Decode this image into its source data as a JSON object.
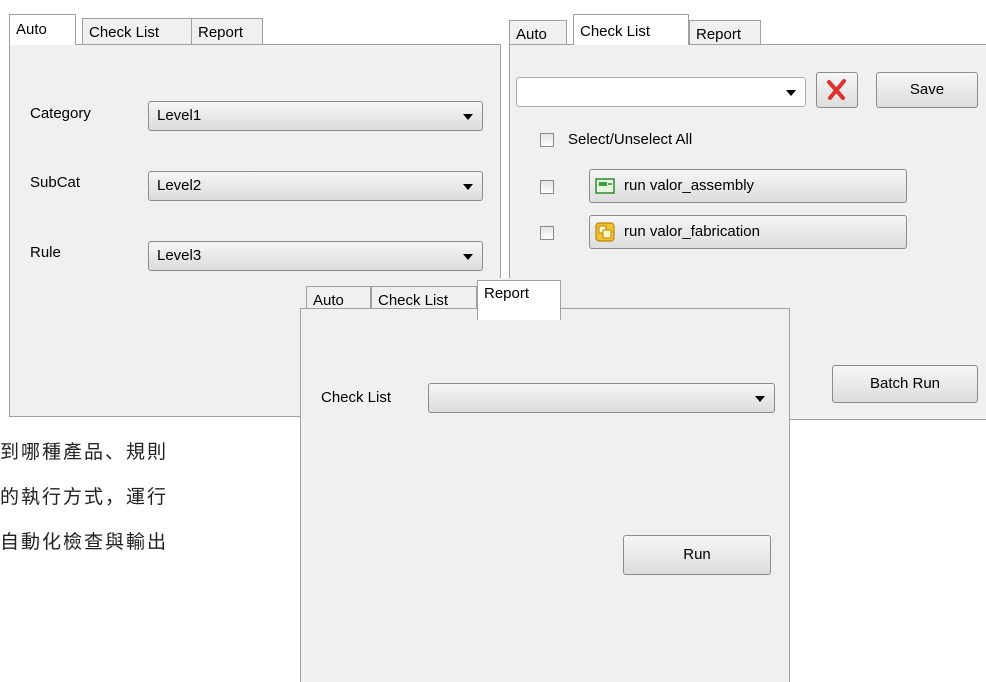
{
  "tabs": [
    "Auto",
    "Check List",
    "Report"
  ],
  "auto_panel": {
    "fields": [
      {
        "label": "Category",
        "value": "Level1"
      },
      {
        "label": "SubCat",
        "value": "Level2"
      },
      {
        "label": "Rule",
        "value": "Level3"
      }
    ]
  },
  "checklist_panel": {
    "dropdown_value": "",
    "save_label": "Save",
    "select_all_label": "Select/Unselect All",
    "items": [
      {
        "label": "run valor_assembly",
        "icon": "assembly-icon",
        "checked": false
      },
      {
        "label": "run valor_fabrication",
        "icon": "fabrication-icon",
        "checked": false
      }
    ],
    "batch_run_label": "Batch Run"
  },
  "report_panel": {
    "checklist_label": "Check List",
    "checklist_value": "",
    "run_label": "Run"
  },
  "background_text": [
    "到哪種產品、規則",
    "的執行方式，運行",
    "自動化檢查與輸出"
  ],
  "colors": {
    "delete_x": "#e03030",
    "panel_bg": "#f0f0f0"
  }
}
